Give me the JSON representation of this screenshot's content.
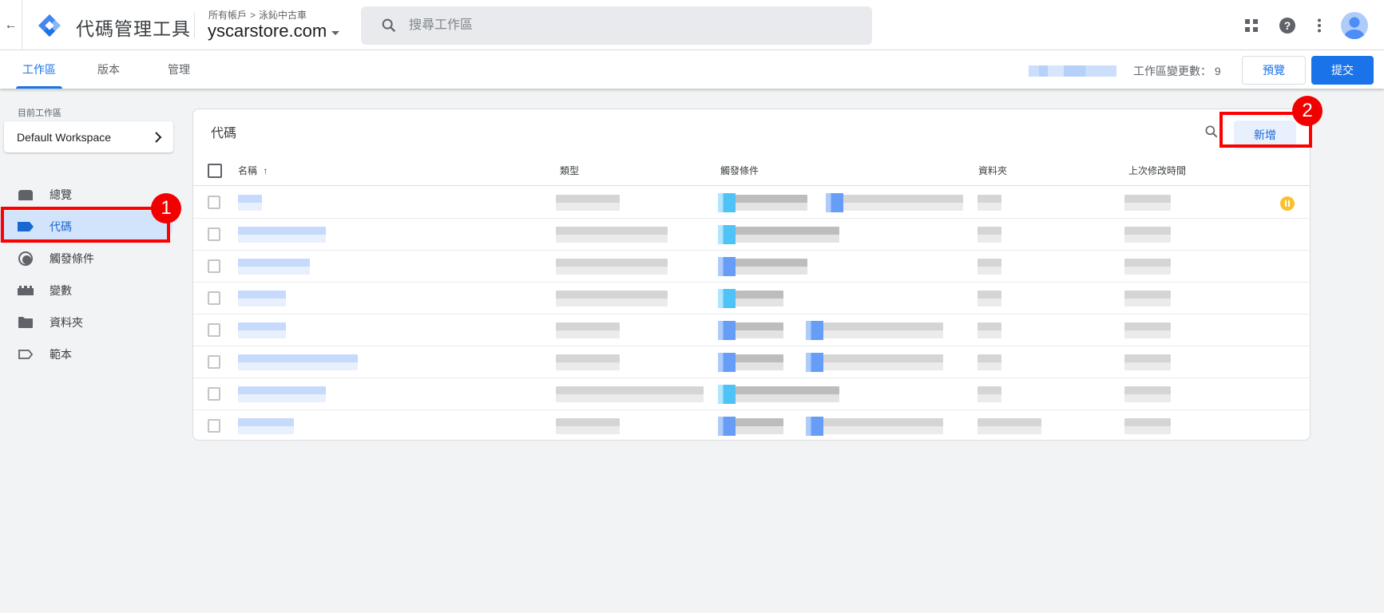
{
  "header": {
    "back_icon": "arrow-back-icon",
    "app_title": "代碼管理工具",
    "breadcrumb": {
      "account_root": "所有帳戶",
      "separator": ">",
      "account": "泳鈊中古車"
    },
    "container": "yscarstore.com",
    "search_placeholder": "搜尋工作區",
    "icons": [
      "apps-grid-icon",
      "help-icon",
      "more-vert-icon",
      "account-avatar-icon"
    ]
  },
  "tabs": [
    {
      "label": "工作區",
      "active": true
    },
    {
      "label": "版本",
      "active": false
    },
    {
      "label": "管理",
      "active": false
    }
  ],
  "toolbar": {
    "workspace_changes_label": "工作區變更數：",
    "workspace_changes_count": "9",
    "preview_label": "預覽",
    "submit_label": "提交"
  },
  "sidebar": {
    "current_workspace_label": "目前工作區",
    "workspace_name": "Default Workspace",
    "items": [
      {
        "label": "總覽",
        "icon": "overview-icon",
        "active": false
      },
      {
        "label": "代碼",
        "icon": "tag-icon",
        "active": true
      },
      {
        "label": "觸發條件",
        "icon": "trigger-icon",
        "active": false
      },
      {
        "label": "變數",
        "icon": "variables-icon",
        "active": false
      },
      {
        "label": "資料夾",
        "icon": "folder-icon",
        "active": false
      },
      {
        "label": "範本",
        "icon": "template-icon",
        "active": false
      }
    ]
  },
  "annotations": [
    {
      "number": "1",
      "target": "sidebar-item-tags"
    },
    {
      "number": "2",
      "target": "new-tag-button"
    }
  ],
  "tags_card": {
    "title": "代碼",
    "new_label": "新增",
    "columns": [
      "名稱",
      "類型",
      "觸發條件",
      "資料夾",
      "上次修改時間"
    ],
    "sort_indicator": "↑",
    "rows_redacted": true,
    "row_count": 8,
    "paused_status_row": 1
  },
  "colors": {
    "accent": "#1a73e8",
    "active_nav_bg": "#d2e3fc",
    "annotation": "#ff0000",
    "paused": "#fbc02d"
  }
}
